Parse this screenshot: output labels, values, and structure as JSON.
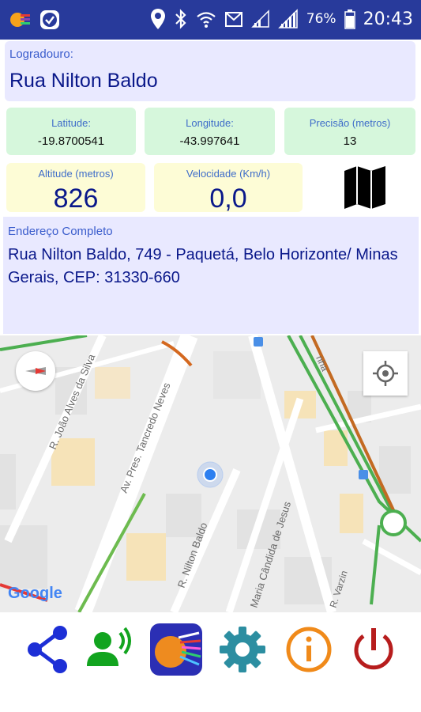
{
  "status_bar": {
    "battery_percent": "76%",
    "time": "20:43",
    "icons": [
      "app-color-icon",
      "check-badge-icon",
      "location-pin-icon",
      "bluetooth-icon",
      "wifi-icon",
      "alarm-icon",
      "signal-icon",
      "signal-icon",
      "battery-icon"
    ]
  },
  "logradouro": {
    "label": "Logradouro:",
    "value": "Rua Nilton Baldo"
  },
  "latitude": {
    "label": "Latitude:",
    "value": "-19.8700541"
  },
  "longitude": {
    "label": "Longitude:",
    "value": "-43.997641"
  },
  "precisao": {
    "label": "Precisão (metros)",
    "value": "13"
  },
  "altitude": {
    "label": "Altitude (metros)",
    "value": "826"
  },
  "velocidade": {
    "label": "Velocidade (Km/h)",
    "value": "0,0"
  },
  "endereco": {
    "label": "Endereço Completo",
    "value": "Rua Nilton Baldo, 749 - Paquetá, Belo Horizonte/ Minas Gerais, CEP: 31330-660"
  },
  "map": {
    "streets": [
      "R. João Alves da Silva",
      "Av. Pres. Tancredo Neves",
      "R. Nilton Baldo",
      "Maria Cândida de Jesus",
      "R. Varzin",
      "nha"
    ],
    "attribution": "Google"
  },
  "toolbar": {
    "buttons": [
      "share-icon",
      "speaker-icon",
      "app-logo-icon",
      "settings-icon",
      "info-icon",
      "power-icon"
    ]
  },
  "colors": {
    "status_bar": "#283a9b",
    "label_blue": "#3f6dc9",
    "value_navy": "#0a188a",
    "green_box": "#d6f7dc",
    "yellow_box": "#fdfcd6",
    "lavender_box": "#e9e9ff"
  }
}
